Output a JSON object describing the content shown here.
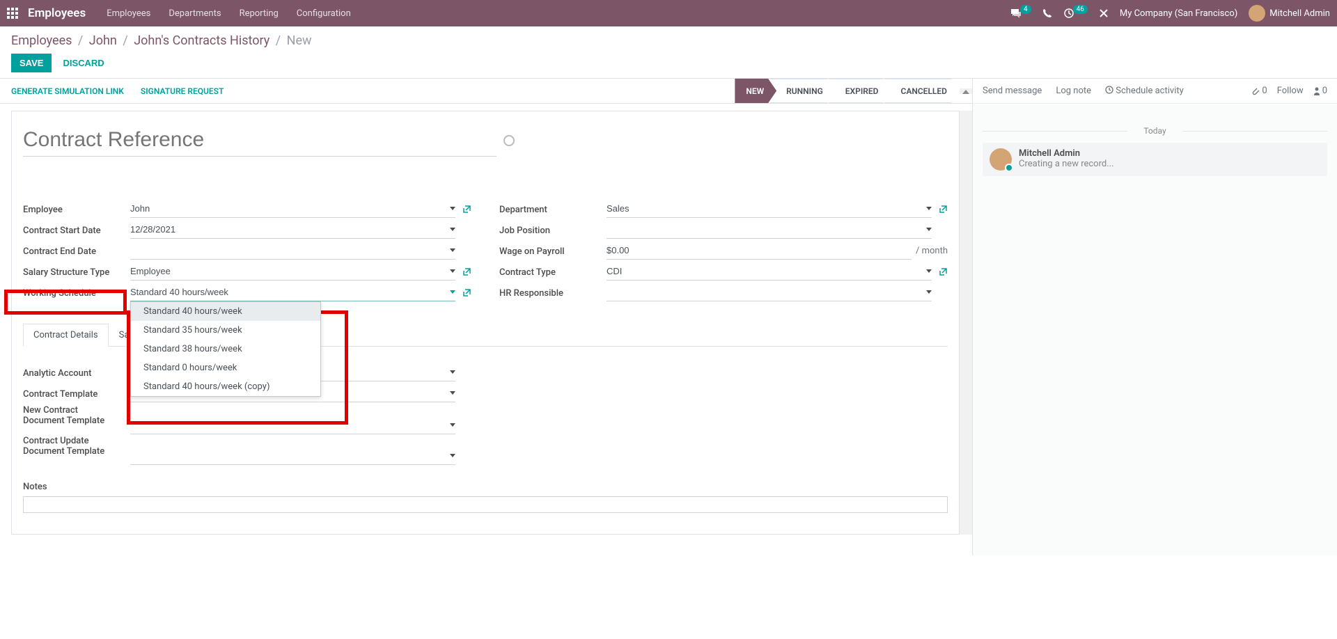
{
  "topnav": {
    "brand": "Employees",
    "menu": [
      "Employees",
      "Departments",
      "Reporting",
      "Configuration"
    ],
    "discuss_badge": "4",
    "activities_badge": "46",
    "company": "My Company (San Francisco)",
    "user": "Mitchell Admin"
  },
  "breadcrumb": {
    "l1": "Employees",
    "l2": "John",
    "l3": "John's Contracts History",
    "current": "New"
  },
  "buttons": {
    "save": "SAVE",
    "discard": "DISCARD"
  },
  "toolbar": {
    "gen": "GENERATE SIMULATION LINK",
    "sig": "SIGNATURE REQUEST"
  },
  "status": {
    "s1": "NEW",
    "s2": "RUNNING",
    "s3": "EXPIRED",
    "s4": "CANCELLED"
  },
  "title_placeholder": "Contract Reference",
  "fields": {
    "left": {
      "employee_label": "Employee",
      "employee": "John",
      "start_label": "Contract Start Date",
      "start": "12/28/2021",
      "end_label": "Contract End Date",
      "end": "",
      "struct_label": "Salary Structure Type",
      "struct": "Employee",
      "sched_label": "Working Schedule",
      "sched": "Standard 40 hours/week"
    },
    "right": {
      "dept_label": "Department",
      "dept": "Sales",
      "job_label": "Job Position",
      "job": "",
      "wage_label": "Wage on Payroll",
      "wage": "$0.00",
      "wage_suffix": "/ month",
      "ctype_label": "Contract Type",
      "ctype": "CDI",
      "hr_label": "HR Responsible",
      "hr": ""
    }
  },
  "dropdown": {
    "opt1": "Standard 40 hours/week",
    "opt2": "Standard 35 hours/week",
    "opt3": "Standard 38 hours/week",
    "opt4": "Standard 0 hours/week",
    "opt5": "Standard 40 hours/week (copy)"
  },
  "tabs": {
    "t1": "Contract Details",
    "t2": "Sa"
  },
  "details": {
    "analytic_label": "Analytic Account",
    "template_label": "Contract Template",
    "new_doc_label1": "New Contract",
    "new_doc_label2": "Document Template",
    "upd_doc_label1": "Contract Update",
    "upd_doc_label2": "Document Template",
    "notes_label": "Notes"
  },
  "chatter": {
    "send": "Send message",
    "log": "Log note",
    "sched": "Schedule activity",
    "attach": "0",
    "follow": "Follow",
    "followers": "0",
    "today": "Today",
    "msg_author": "Mitchell Admin",
    "msg_body": "Creating a new record..."
  }
}
